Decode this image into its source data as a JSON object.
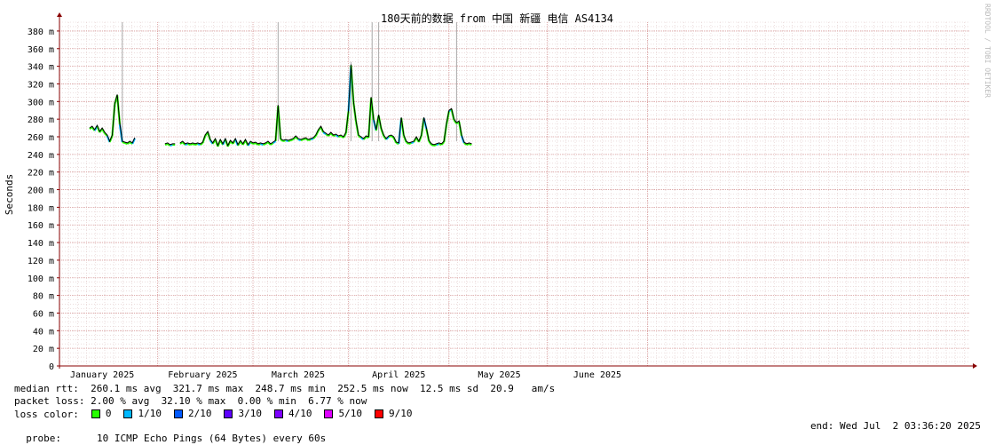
{
  "chart_data": {
    "type": "line",
    "title": "180天前的数据 from 中国 新疆 电信 AS4134",
    "ylabel": "Seconds",
    "xlabel": "",
    "ylim": [
      0,
      390
    ],
    "yticks": [
      {
        "v": 0,
        "label": "0"
      },
      {
        "v": 20,
        "label": "20 m"
      },
      {
        "v": 40,
        "label": "40 m"
      },
      {
        "v": 60,
        "label": "60 m"
      },
      {
        "v": 80,
        "label": "80 m"
      },
      {
        "v": 100,
        "label": "100 m"
      },
      {
        "v": 120,
        "label": "120 m"
      },
      {
        "v": 140,
        "label": "140 m"
      },
      {
        "v": 160,
        "label": "160 m"
      },
      {
        "v": 180,
        "label": "180 m"
      },
      {
        "v": 200,
        "label": "200 m"
      },
      {
        "v": 220,
        "label": "220 m"
      },
      {
        "v": 240,
        "label": "240 m"
      },
      {
        "v": 260,
        "label": "260 m"
      },
      {
        "v": 280,
        "label": "280 m"
      },
      {
        "v": 300,
        "label": "300 m"
      },
      {
        "v": 320,
        "label": "320 m"
      },
      {
        "v": 340,
        "label": "340 m"
      },
      {
        "v": 360,
        "label": "360 m"
      },
      {
        "v": 380,
        "label": "380 m"
      }
    ],
    "xlim": [
      0,
      181
    ],
    "xticks": [
      {
        "v": 8.5,
        "label": "January 2025"
      },
      {
        "v": 28.5,
        "label": "February 2025"
      },
      {
        "v": 47.5,
        "label": "March 2025"
      },
      {
        "v": 67.5,
        "label": "April 2025"
      },
      {
        "v": 87.5,
        "label": "May 2025"
      },
      {
        "v": 107,
        "label": "June 2025"
      }
    ],
    "x_unit": "days since Jan 2025 offset",
    "grid": true,
    "series": [
      {
        "name": "median rtt",
        "segments": [
          [
            [
              6,
              270
            ],
            [
              6.5,
              272
            ],
            [
              7,
              268
            ],
            [
              7.5,
              273
            ],
            [
              8,
              266
            ],
            [
              8.5,
              270
            ],
            [
              9,
              265
            ],
            [
              9.5,
              262
            ],
            [
              10,
              255
            ],
            [
              10.5,
              262
            ],
            [
              11,
              298
            ],
            [
              11.5,
              308
            ],
            [
              12,
              275
            ],
            [
              12.5,
              255
            ],
            [
              13,
              254
            ],
            [
              13.5,
              253
            ],
            [
              14,
              255
            ],
            [
              14.5,
              253
            ],
            [
              15,
              259
            ]
          ],
          [
            [
              21,
              252
            ],
            [
              21.5,
              253
            ],
            [
              22,
              251
            ],
            [
              22.5,
              252
            ],
            [
              23,
              252
            ]
          ],
          [
            [
              24,
              253
            ],
            [
              24.5,
              255
            ],
            [
              25,
              252
            ],
            [
              25.5,
              253
            ],
            [
              26,
              252
            ],
            [
              26.5,
              253
            ],
            [
              27,
              252
            ],
            [
              27.5,
              253
            ],
            [
              28,
              252
            ],
            [
              28.5,
              254
            ],
            [
              29,
              262
            ],
            [
              29.5,
              266
            ],
            [
              30,
              257
            ],
            [
              30.5,
              253
            ],
            [
              31,
              258
            ],
            [
              31.5,
              250
            ],
            [
              32,
              257
            ],
            [
              32.5,
              252
            ],
            [
              33,
              258
            ],
            [
              33.5,
              250
            ],
            [
              34,
              256
            ],
            [
              34.5,
              253
            ],
            [
              35,
              258
            ],
            [
              35.5,
              251
            ],
            [
              36,
              256
            ],
            [
              36.5,
              252
            ],
            [
              37,
              257
            ],
            [
              37.5,
              251
            ],
            [
              38,
              255
            ],
            [
              38.5,
              253
            ],
            [
              39,
              254
            ],
            [
              39.5,
              252
            ],
            [
              40,
              253
            ],
            [
              40.5,
              252
            ],
            [
              41,
              253
            ],
            [
              41.5,
              255
            ],
            [
              42,
              252
            ],
            [
              42.5,
              254
            ],
            [
              43,
              256
            ],
            [
              43.5,
              296
            ],
            [
              44,
              258
            ],
            [
              44.5,
              256
            ],
            [
              45,
              257
            ],
            [
              45.5,
              256
            ],
            [
              46,
              257
            ],
            [
              46.5,
              258
            ],
            [
              47,
              261
            ],
            [
              47.5,
              258
            ],
            [
              48,
              257
            ],
            [
              48.5,
              258
            ],
            [
              49,
              259
            ],
            [
              49.5,
              257
            ],
            [
              50,
              258
            ],
            [
              50.5,
              259
            ],
            [
              51,
              262
            ],
            [
              51.5,
              268
            ],
            [
              52,
              272
            ],
            [
              52.5,
              266
            ],
            [
              53,
              264
            ],
            [
              53.5,
              262
            ],
            [
              54,
              265
            ],
            [
              54.5,
              262
            ],
            [
              55,
              263
            ],
            [
              55.5,
              261
            ],
            [
              56,
              262
            ],
            [
              56.5,
              260
            ],
            [
              57,
              265
            ],
            [
              57.5,
              290
            ],
            [
              58,
              342
            ],
            [
              58.5,
              300
            ],
            [
              59,
              278
            ],
            [
              59.5,
              262
            ],
            [
              60,
              260
            ],
            [
              60.5,
              258
            ],
            [
              61,
              261
            ],
            [
              61.5,
              260
            ],
            [
              62,
              305
            ],
            [
              62.5,
              280
            ],
            [
              63,
              268
            ],
            [
              63.5,
              285
            ],
            [
              64,
              270
            ],
            [
              64.5,
              262
            ],
            [
              65,
              258
            ],
            [
              65.5,
              261
            ],
            [
              66,
              262
            ],
            [
              66.5,
              260
            ],
            [
              67,
              254
            ],
            [
              67.5,
              253
            ],
            [
              68,
              282
            ],
            [
              68.5,
              262
            ],
            [
              69,
              255
            ],
            [
              69.5,
              253
            ],
            [
              70,
              254
            ],
            [
              70.5,
              255
            ],
            [
              71,
              260
            ],
            [
              71.5,
              255
            ],
            [
              72,
              262
            ],
            [
              72.5,
              282
            ],
            [
              73,
              270
            ],
            [
              73.5,
              256
            ],
            [
              74,
              252
            ],
            [
              74.5,
              251
            ],
            [
              75,
              252
            ],
            [
              75.5,
              253
            ],
            [
              76,
              252
            ],
            [
              76.5,
              255
            ],
            [
              77,
              275
            ],
            [
              77.5,
              290
            ],
            [
              78,
              292
            ],
            [
              78.5,
              280
            ],
            [
              79,
              276
            ],
            [
              79.5,
              278
            ],
            [
              80,
              262
            ],
            [
              80.5,
              254
            ],
            [
              81,
              252
            ],
            [
              81.5,
              253
            ],
            [
              82,
              252
            ]
          ]
        ]
      }
    ],
    "max_lines": [
      {
        "x": 12.5,
        "top": 390
      },
      {
        "x": 43.5,
        "top": 390
      },
      {
        "x": 58.0,
        "top": 345
      },
      {
        "x": 62.2,
        "top": 390
      },
      {
        "x": 63.5,
        "top": 390
      },
      {
        "x": 79.0,
        "top": 390
      }
    ],
    "series_colors": {
      "line": "#000000",
      "loss0": "#26ff00",
      "loss1": "#00b8ff",
      "loss2": "#0059ff"
    },
    "grid_colors": {
      "minor": "#e0c8c8",
      "major": "#d89a9a",
      "axis": "#880000"
    }
  },
  "stats": {
    "rtt_line": "median rtt:  260.1 ms avg  321.7 ms max  248.7 ms min  252.5 ms now  12.5 ms sd  20.9   am/s",
    "loss_line": "packet loss: 2.00 % avg  32.10 % max  0.00 % min  6.77 % now",
    "loss_color_label": "loss color:"
  },
  "legend": [
    {
      "label": "0",
      "color": "#26ff00"
    },
    {
      "label": "1/10",
      "color": "#00b8ff"
    },
    {
      "label": "2/10",
      "color": "#0059ff"
    },
    {
      "label": "3/10",
      "color": "#5e00ff"
    },
    {
      "label": "4/10",
      "color": "#7e00ff"
    },
    {
      "label": "5/10",
      "color": "#dd00ff"
    },
    {
      "label": "9/10",
      "color": "#ff0000"
    }
  ],
  "probe": {
    "label": "probe:",
    "text": "10 ICMP Echo Pings (64 Bytes) every 60s",
    "end": "end: Wed Jul  2 03:36:20 2025"
  },
  "watermark": "RRDTOOL / TOBI OETIKER"
}
